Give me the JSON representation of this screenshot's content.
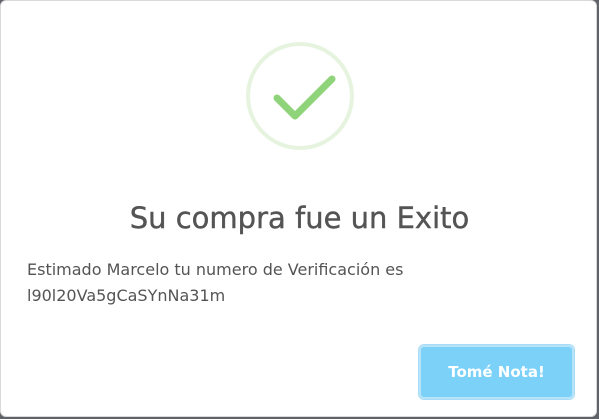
{
  "dialog": {
    "icon": "success-checkmark-icon",
    "title": "Su compra fue un Exito",
    "message_line1": "Estimado Marcelo tu numero de Verificación es",
    "message_line2": "l90l20Va5gCaSYnNa31m",
    "confirm_label": "Tomé Nota!"
  },
  "colors": {
    "check": "#8fd47a",
    "check_ring": "#e6f3df",
    "button": "#7cd1f9",
    "text": "#545454"
  }
}
